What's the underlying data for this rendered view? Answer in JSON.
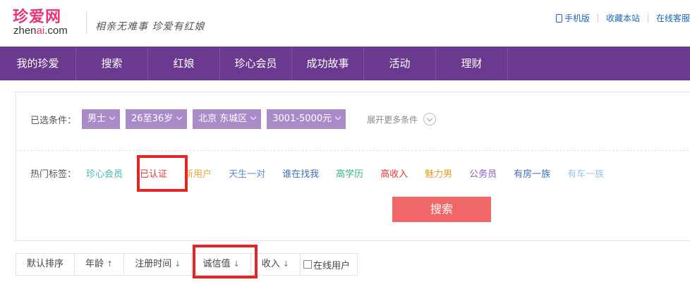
{
  "header": {
    "logo_cn": "珍爱网",
    "logo_en_prefix": "zhen",
    "logo_en_ai": "ai",
    "logo_en_suffix": ".com",
    "slogan": "相亲无难事 珍爱有红娘",
    "links": {
      "mobile": "手机版",
      "favorite": "收藏本站",
      "service": "在线客服"
    }
  },
  "nav": {
    "items": [
      "我的珍爱",
      "搜索",
      "红娘",
      "珍心会员",
      "成功故事",
      "活动",
      "理财"
    ]
  },
  "filter": {
    "label": "已选条件：",
    "chips": [
      "男士",
      "26至36岁",
      "北京 东城区",
      "3001-5000元"
    ],
    "more": "展开更多条件"
  },
  "tags": {
    "label": "热门标签：",
    "items": [
      {
        "text": "珍心会员",
        "color": "#3db8b0"
      },
      {
        "text": "已认证",
        "color": "#e8343f"
      },
      {
        "text": "新用户",
        "color": "#f4a036"
      },
      {
        "text": "天生一对",
        "color": "#5b8ed6"
      },
      {
        "text": "谁在找我",
        "color": "#3d6fb8"
      },
      {
        "text": "高学历",
        "color": "#37b089"
      },
      {
        "text": "高收入",
        "color": "#e8343f"
      },
      {
        "text": "魅力男",
        "color": "#e0a020"
      },
      {
        "text": "公务员",
        "color": "#8a5cbf"
      },
      {
        "text": "有房一族",
        "color": "#3d6fb8"
      },
      {
        "text": "有车一族",
        "color": "#9cc4e8"
      }
    ]
  },
  "search_button": "搜索",
  "sort": {
    "default": "默认排序",
    "age": "年龄",
    "reg_time": "注册时间",
    "credit": "诚信值",
    "income": "收入",
    "online": "在线用户",
    "arrow_up": "↑",
    "arrow_down": "↓"
  },
  "colors": {
    "brand_pink": "#e6357a",
    "nav_purple": "#6b3a8f",
    "chip_purple": "#a98bc8",
    "search_red": "#f06767",
    "highlight_red": "#e52424"
  }
}
